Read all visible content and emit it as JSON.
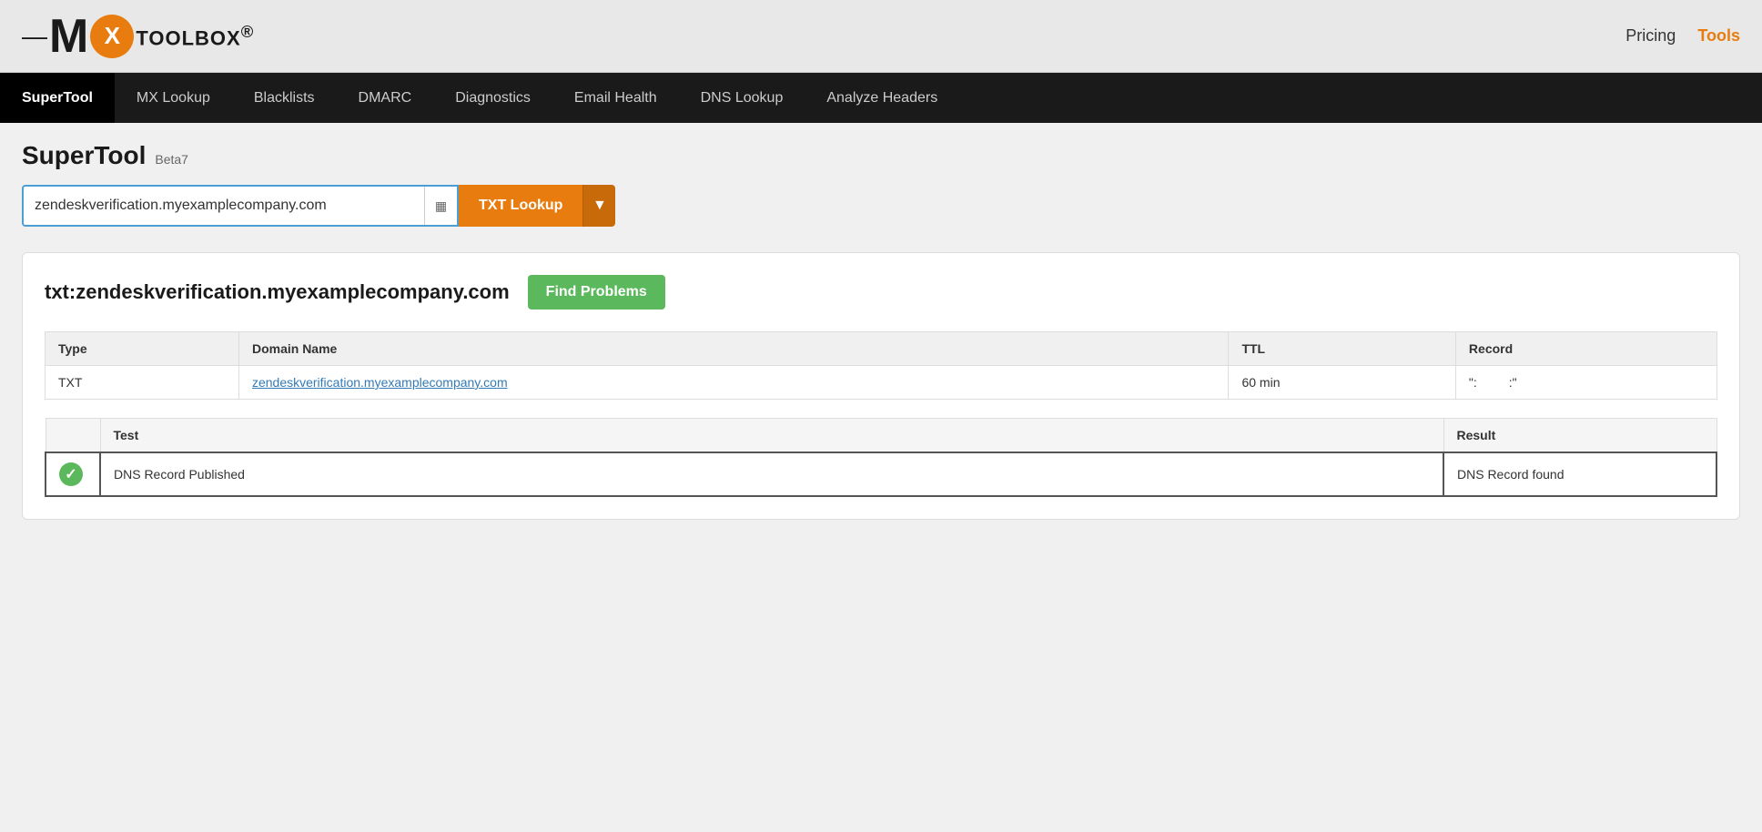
{
  "header": {
    "logo": {
      "dash": "—",
      "m": "M",
      "x": "X",
      "toolbox": "TOOLBOX",
      "reg": "®"
    },
    "nav": {
      "pricing": "Pricing",
      "tools": "Tools"
    }
  },
  "navbar": {
    "items": [
      {
        "id": "supertool",
        "label": "SuperTool",
        "active": true
      },
      {
        "id": "mx-lookup",
        "label": "MX Lookup",
        "active": false
      },
      {
        "id": "blacklists",
        "label": "Blacklists",
        "active": false
      },
      {
        "id": "dmarc",
        "label": "DMARC",
        "active": false
      },
      {
        "id": "diagnostics",
        "label": "Diagnostics",
        "active": false
      },
      {
        "id": "email-health",
        "label": "Email Health",
        "active": false
      },
      {
        "id": "dns-lookup",
        "label": "DNS Lookup",
        "active": false
      },
      {
        "id": "analyze-headers",
        "label": "Analyze Headers",
        "active": false
      }
    ]
  },
  "page": {
    "title": "SuperTool",
    "badge": "Beta7",
    "search": {
      "value": "zendeskverification.myexamplecompany.com",
      "placeholder": "Domain or IP address",
      "button_label": "TXT Lookup",
      "dropdown_arrow": "▼"
    }
  },
  "results": {
    "domain_label": "txt:zendeskverification.myexamplecompany.com",
    "find_problems_label": "Find Problems",
    "table": {
      "columns": [
        "Type",
        "Domain Name",
        "TTL",
        "Record"
      ],
      "rows": [
        {
          "type": "TXT",
          "domain": "zendeskverification.myexamplecompany.com",
          "ttl": "60 min",
          "record": "\":         :\""
        }
      ]
    },
    "tests": {
      "columns": [
        "",
        "Test",
        "Result"
      ],
      "rows": [
        {
          "status": "pass",
          "test": "DNS Record Published",
          "result": "DNS Record found"
        }
      ]
    }
  }
}
